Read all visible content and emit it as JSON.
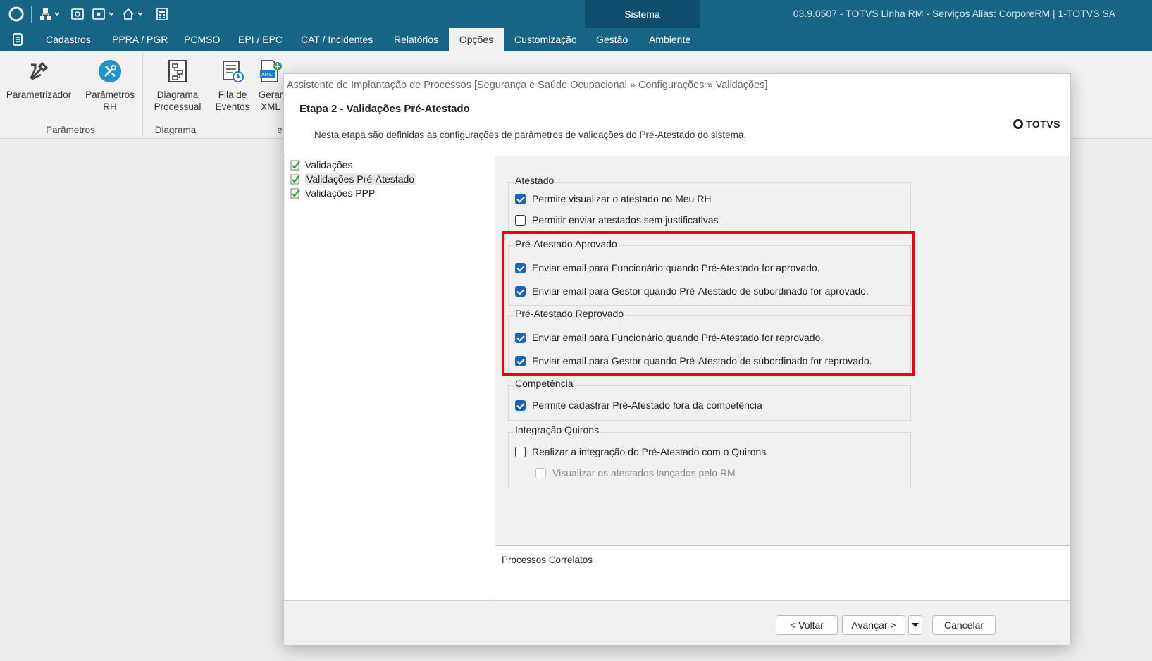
{
  "titlebar": {
    "sistema": "Sistema",
    "info": "03.9.0507 - TOTVS Linha RM - Serviços  Alias: CorporeRM | 1-TOTVS SA"
  },
  "menu": {
    "items": [
      "Cadastros",
      "PPRA / PGR",
      "PCMSO",
      "EPI / EPC",
      "CAT / Incidentes",
      "Relatórios",
      "Opções",
      "Customização",
      "Gestão",
      "Ambiente"
    ],
    "active": "Opções"
  },
  "ribbon": {
    "buttons": [
      {
        "label1": "Parametrizador",
        "label2": ""
      },
      {
        "label1": "Parâmetros",
        "label2": "RH"
      },
      {
        "label1": "Diagrama",
        "label2": "Processual"
      },
      {
        "label1": "Fila de",
        "label2": "Eventos"
      },
      {
        "label1": "Gerar",
        "label2": "XML"
      }
    ],
    "groups": {
      "parametros": "Parâmetros",
      "diagrama": "Diagrama",
      "partial": "e"
    }
  },
  "dialog": {
    "title": "Assistente de Implantação de Processos [Segurança e Saúde Ocupacional » Configurações » Validações]",
    "step_title": "Etapa 2 - Validações Pré-Atestado",
    "step_desc": "Nesta etapa são definidas as configurações de parâmetros de validações do Pré-Atestado do sistema.",
    "logo": "TOTVS",
    "tree": [
      {
        "label": "Validações"
      },
      {
        "label": "Validações Pré-Atestado"
      },
      {
        "label": "Validações PPP"
      }
    ],
    "groups": {
      "atestado": {
        "title": "Atestado",
        "options": [
          {
            "label": "Permite visualizar o atestado no Meu RH",
            "checked": true
          },
          {
            "label": "Permitir enviar atestados sem justificativas",
            "checked": false
          }
        ]
      },
      "aprovado": {
        "title": "Pré-Atestado Aprovado",
        "options": [
          {
            "label": "Enviar email para Funcionário quando Pré-Atestado for aprovado.",
            "checked": true
          },
          {
            "label": "Enviar email para Gestor quando Pré-Atestado de subordinado for aprovado.",
            "checked": true
          }
        ]
      },
      "reprovado": {
        "title": "Pré-Atestado Reprovado",
        "options": [
          {
            "label": "Enviar email para Funcionário quando Pré-Atestado for reprovado.",
            "checked": true
          },
          {
            "label": "Enviar email para Gestor quando Pré-Atestado de subordinado for reprovado.",
            "checked": true
          }
        ]
      },
      "competencia": {
        "title": "Competência",
        "options": [
          {
            "label": "Permite cadastrar Pré-Atestado fora da competência",
            "checked": true
          }
        ]
      },
      "quirons": {
        "title": "Integração Quirons",
        "options": [
          {
            "label": "Realizar a integração do Pré-Atestado com o Quirons",
            "checked": false
          },
          {
            "label": "Visualizar os atestados lançados pelo RM",
            "checked": false,
            "disabled": true
          }
        ]
      }
    },
    "related_title": "Processos Correlatos",
    "buttons": {
      "back": "< Voltar",
      "next": "Avançar >",
      "cancel": "Cancelar"
    }
  },
  "colors": {
    "titlebar": "#166584",
    "highlight": "#e30613",
    "checkbox": "#1a63b8"
  }
}
